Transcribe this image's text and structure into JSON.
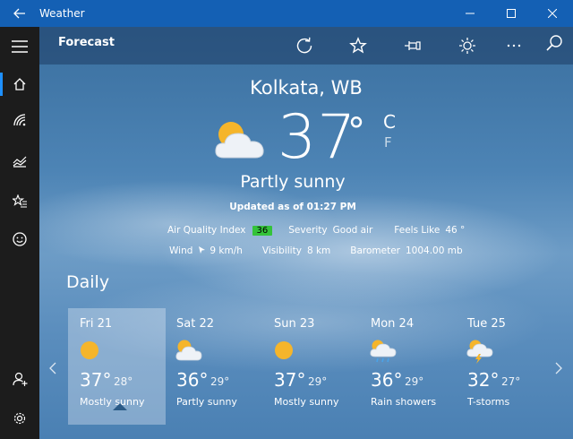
{
  "window": {
    "title": "Weather"
  },
  "command_bar": {
    "title": "Forecast"
  },
  "current": {
    "city": "Kolkata, WB",
    "temperature": "37",
    "degree_symbol": "°",
    "unit_c": "C",
    "unit_f": "F",
    "condition": "Partly sunny",
    "updated": "Updated as of 01:27 PM"
  },
  "details": {
    "aqi_label": "Air Quality Index",
    "aqi_value": "36",
    "severity_label": "Severity",
    "severity_value": "Good air",
    "feels_like_label": "Feels Like",
    "feels_like_value": "46 °",
    "wind_label": "Wind",
    "wind_value": "9 km/h",
    "visibility_label": "Visibility",
    "visibility_value": "8 km",
    "barometer_label": "Barometer",
    "barometer_value": "1004.00 mb"
  },
  "daily": {
    "title": "Daily",
    "days": [
      {
        "name": "Fri 21",
        "hi": "37°",
        "lo": "28°",
        "condition": "Mostly sunny",
        "icon": "sun-icon"
      },
      {
        "name": "Sat 22",
        "hi": "36°",
        "lo": "29°",
        "condition": "Partly sunny",
        "icon": "partly-sunny-icon"
      },
      {
        "name": "Sun 23",
        "hi": "37°",
        "lo": "29°",
        "condition": "Mostly sunny",
        "icon": "sun-icon"
      },
      {
        "name": "Mon 24",
        "hi": "36°",
        "lo": "29°",
        "condition": "Rain showers",
        "icon": "rain-showers-icon"
      },
      {
        "name": "Tue 25",
        "hi": "32°",
        "lo": "27°",
        "condition": "T-storms",
        "icon": "thunderstorm-icon"
      }
    ]
  },
  "colors": {
    "titlebar": "#1460b4",
    "rail": "#1c1c1c",
    "accent": "#1e90ff",
    "aqi_good": "#34c33a"
  }
}
